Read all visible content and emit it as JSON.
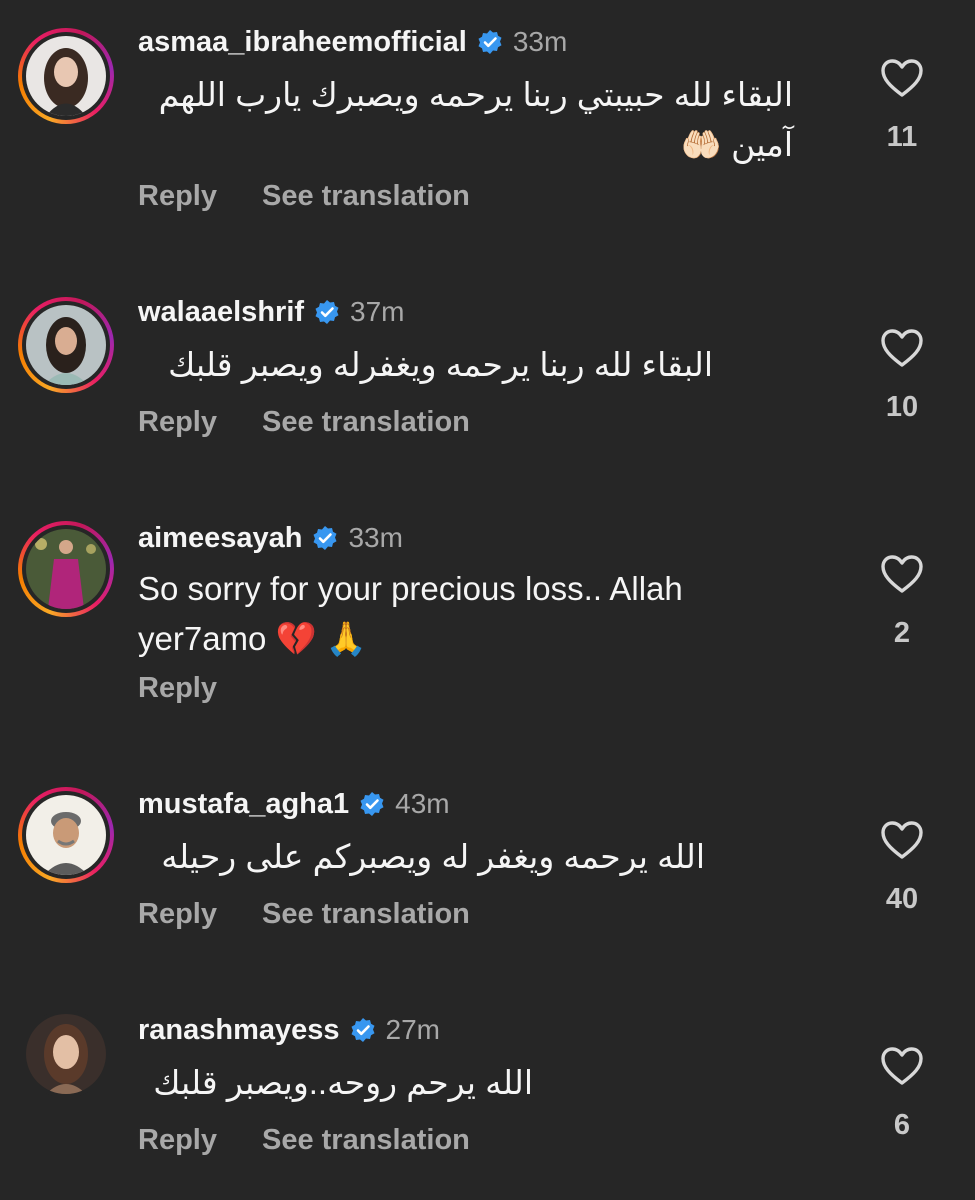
{
  "comments": [
    {
      "username": "asmaa_ibraheemofficial",
      "verified": true,
      "time": "33m",
      "text_lines": [
        "البقاء لله حبيبتي ربنا يرحمه ويصبرك يارب اللهم",
        "آمين 🤲🏻"
      ],
      "actions": [
        "Reply",
        "See translation"
      ],
      "likes": "11"
    },
    {
      "username": "walaaelshrif",
      "verified": true,
      "time": "37m",
      "text_lines": [
        "البقاء لله ربنا يرحمه ويغفرله  ويصبر قلبك"
      ],
      "actions": [
        "Reply",
        "See translation"
      ],
      "likes": "10"
    },
    {
      "username": "aimeesayah",
      "verified": true,
      "time": "33m",
      "text_lines": [
        "So sorry for your precious loss.. Allah",
        "yer7amo 💔 🙏"
      ],
      "actions": [
        "Reply"
      ],
      "likes": "2"
    },
    {
      "username": "mustafa_agha1",
      "verified": true,
      "time": "43m",
      "text_lines": [
        "الله يرحمه ويغفر له ويصبركم على  رحيله"
      ],
      "actions": [
        "Reply",
        "See translation"
      ],
      "likes": "40"
    },
    {
      "username": "ranashmayess",
      "verified": true,
      "time": "27m",
      "text_lines": [
        "الله يرحم روحه..ويصبر قلبك"
      ],
      "actions": [
        "Reply",
        "See translation"
      ],
      "likes": "6"
    }
  ],
  "icons": {
    "verified": "verified-badge-icon",
    "like": "heart-outline-icon"
  },
  "colors": {
    "background": "#262626",
    "verified": "#3897f0",
    "secondary_text": "#a8a8a8"
  }
}
